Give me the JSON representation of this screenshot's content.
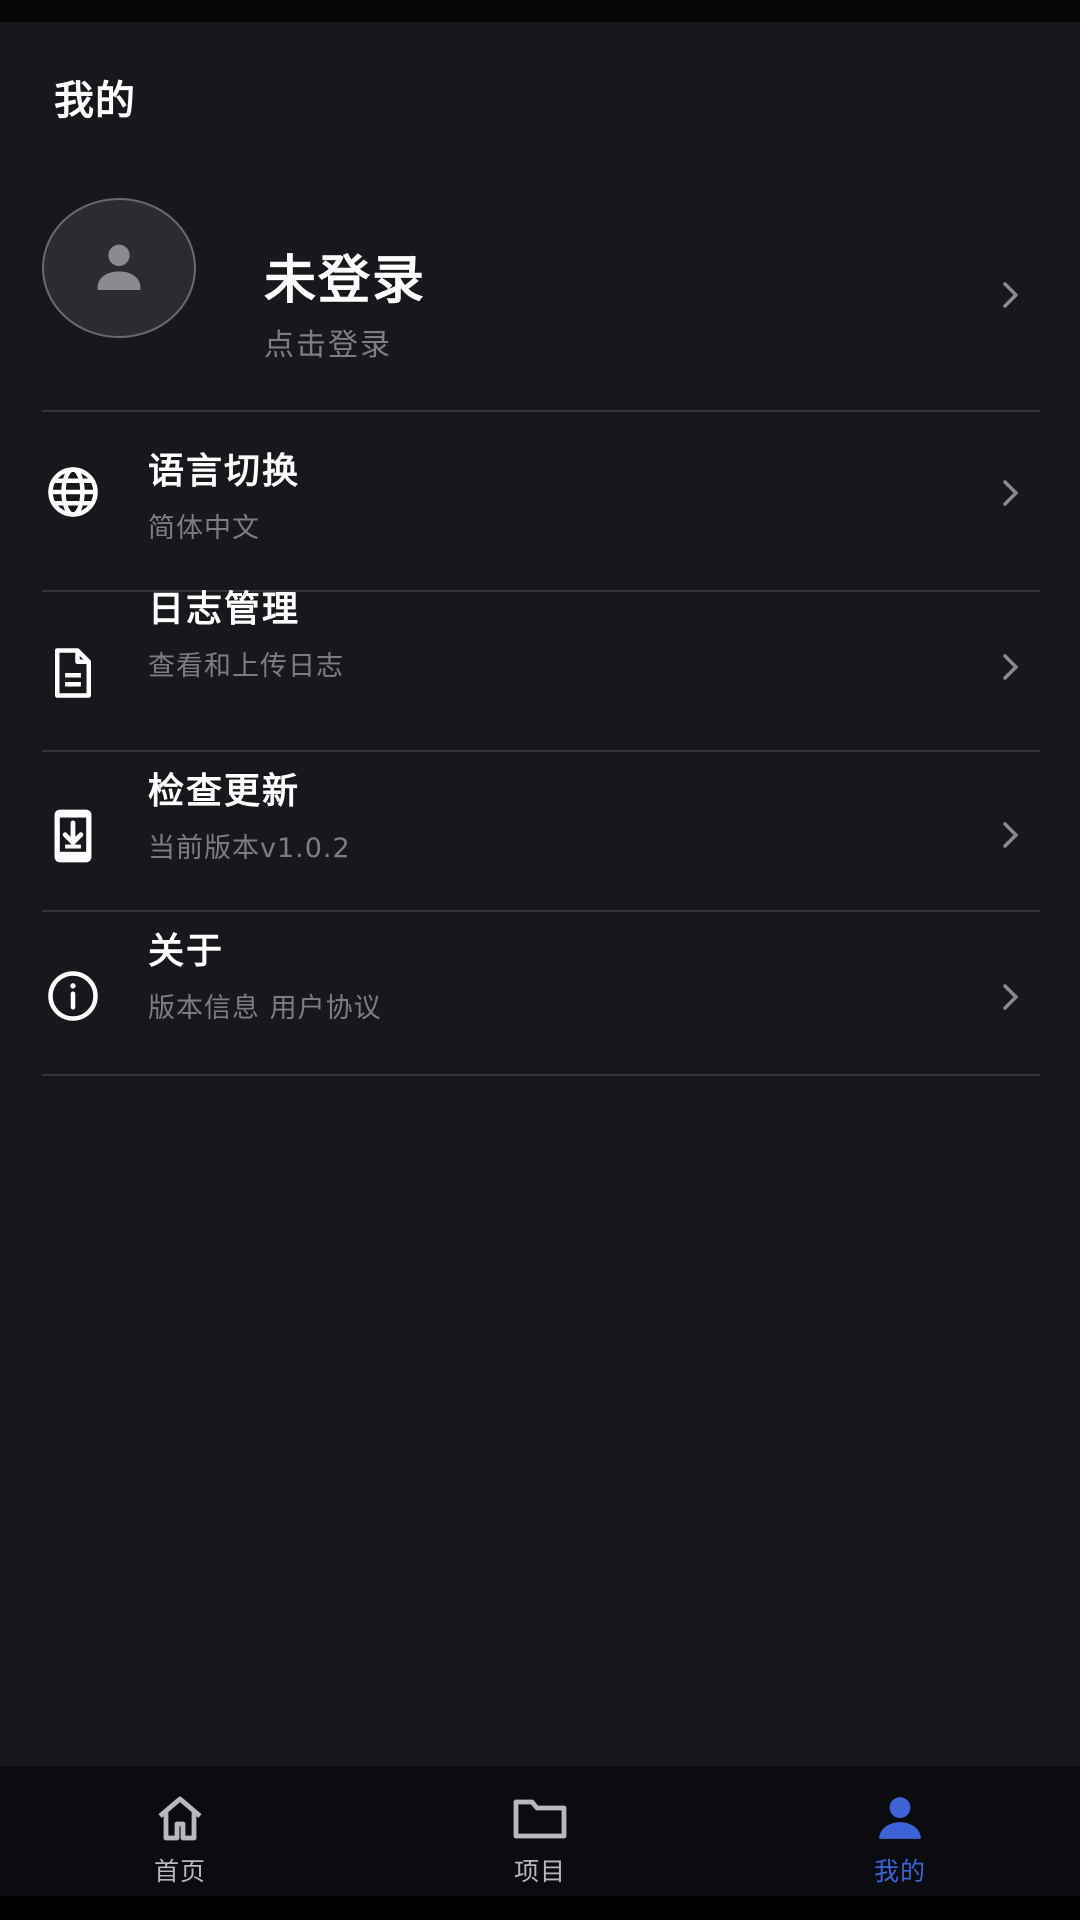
{
  "header": {
    "title": "我的"
  },
  "profile": {
    "name": "未登录",
    "subtitle": "点击登录",
    "avatar_icon": "person-icon"
  },
  "menu": [
    {
      "icon": "globe-icon",
      "label": "语言切换",
      "subtitle": "简体中文"
    },
    {
      "icon": "document-icon",
      "label": "日志管理",
      "subtitle": "查看和上传日志"
    },
    {
      "icon": "download-device-icon",
      "label": "检查更新",
      "subtitle": "当前版本v1.0.2"
    },
    {
      "icon": "info-icon",
      "label": "关于",
      "subtitle": "版本信息 用户协议"
    }
  ],
  "bottom_nav": {
    "items": [
      {
        "icon": "home-icon",
        "label": "首页",
        "active": false
      },
      {
        "icon": "folder-icon",
        "label": "项目",
        "active": false
      },
      {
        "icon": "person-icon",
        "label": "我的",
        "active": true
      }
    ]
  },
  "colors": {
    "background": "#17181c",
    "accent": "#3d63d6",
    "secondary_text": "#7d7e84"
  }
}
